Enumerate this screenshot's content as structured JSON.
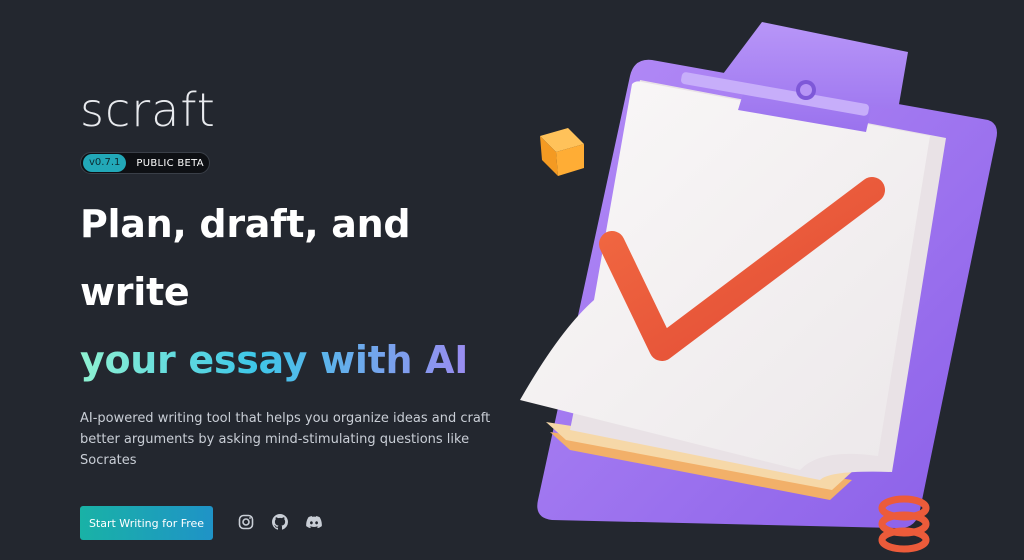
{
  "brand": {
    "name": "scraft"
  },
  "badge": {
    "version": "v0.7.1",
    "label": "PUBLIC BETA"
  },
  "hero": {
    "line1": "Plan, draft, and",
    "line2": "write",
    "line3": "your essay with AI",
    "description": "AI-powered writing tool that helps you organize ideas and craft better arguments by asking mind-stimulating questions like Socrates"
  },
  "cta": {
    "label": "Start Writing for Free"
  },
  "socials": [
    {
      "icon": "instagram-icon"
    },
    {
      "icon": "github-icon"
    },
    {
      "icon": "discord-icon"
    }
  ],
  "colors": {
    "background": "#23272f",
    "accent_teal": "#19b2a6",
    "accent_blue": "#1f93c7",
    "gradient_start": "#8ff2d2",
    "gradient_end": "#9a8cf0",
    "clipboard_purple": "#9b6cf0",
    "check_orange": "#ee5a3a"
  }
}
